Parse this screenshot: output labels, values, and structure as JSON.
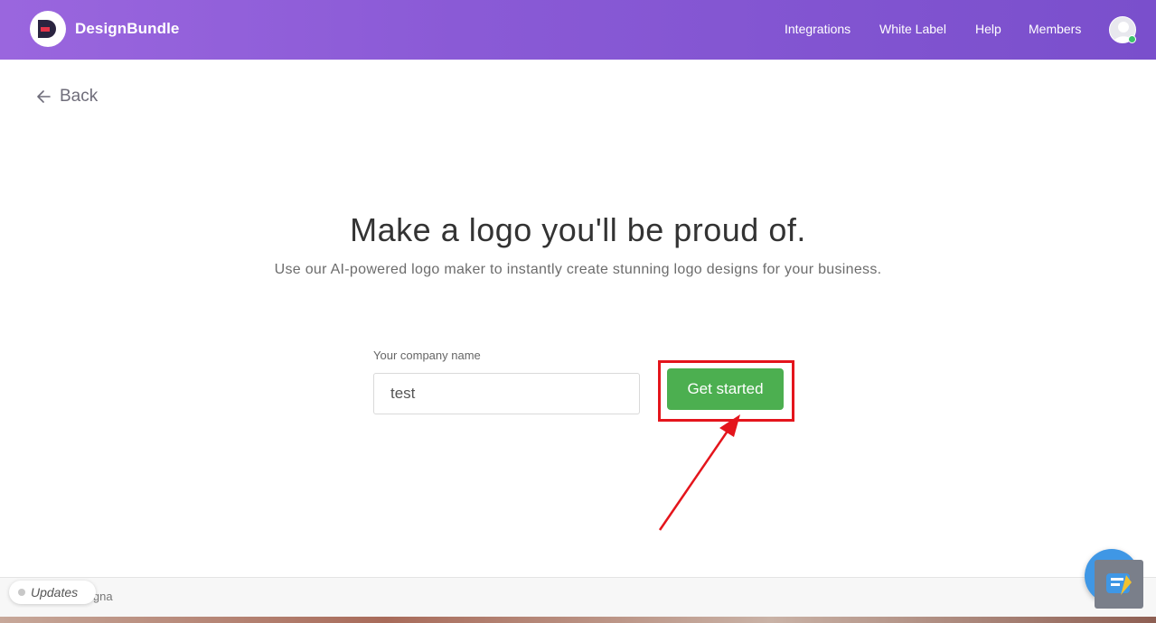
{
  "header": {
    "brand_name": "DesignBundle",
    "nav": [
      "Integrations",
      "White Label",
      "Help",
      "Members"
    ]
  },
  "back": {
    "label": "Back"
  },
  "hero": {
    "title": "Make a logo you'll be proud of.",
    "subtitle": "Use our AI-powered logo maker to instantly create stunning logo designs for your business."
  },
  "form": {
    "company_label": "Your company name",
    "company_value": "test",
    "submit_label": "Get started"
  },
  "footer": {
    "updates_label": "Updates",
    "partial_text": "igna"
  },
  "colors": {
    "header_gradient_start": "#9a66de",
    "header_gradient_end": "#7a4fcc",
    "button_green": "#4caf50",
    "highlight_red": "#e4151c"
  },
  "icons": {
    "brand": "designbundle-logo-icon",
    "back": "arrow-left-icon",
    "avatar": "user-avatar-icon",
    "widget": "chat-widget-icon"
  }
}
